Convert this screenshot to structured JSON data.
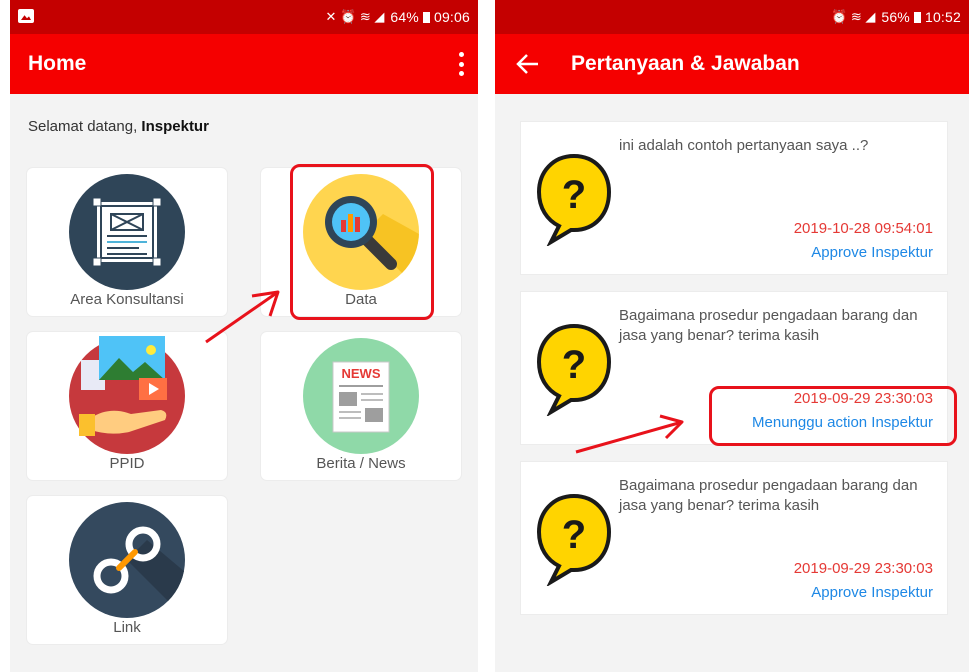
{
  "left_screen": {
    "status_bar": {
      "icons": "✕⚙ ✇ .▎",
      "battery": "64%",
      "time": "09:06"
    },
    "app_bar": {
      "title": "Home"
    },
    "welcome": {
      "prefix": "Selamat datang, ",
      "name": "Inspektur"
    },
    "tiles": [
      {
        "label": "Area Konsultansi",
        "icon": "blueprint-icon"
      },
      {
        "label": "Data",
        "icon": "magnifier-chart-icon"
      },
      {
        "label": "PPID",
        "icon": "media-hand-icon"
      },
      {
        "label": "Berita / News",
        "icon": "newspaper-icon",
        "badge": "NEWS"
      },
      {
        "label": "Link",
        "icon": "chain-link-icon"
      }
    ]
  },
  "right_screen": {
    "status_bar": {
      "battery": "56%",
      "time": "10:52"
    },
    "app_bar": {
      "title": "Pertanyaan & Jawaban"
    },
    "questions": [
      {
        "text": "ini adalah contoh pertanyaan saya ..?",
        "date": "2019-10-28 09:54:01",
        "status": "Approve Inspektur"
      },
      {
        "text": "Bagaimana prosedur pengadaan barang dan jasa yang benar? terima kasih",
        "date": "2019-09-29 23:30:03",
        "status": "Menunggu action Inspektur"
      },
      {
        "text": "Bagaimana prosedur pengadaan barang dan jasa yang benar? terima kasih",
        "date": "2019-09-29 23:30:03",
        "status": "Approve Inspektur"
      }
    ]
  },
  "colors": {
    "status_bar": "#c40000",
    "app_bar": "#f50000",
    "date_text": "#e53935",
    "status_text": "#1e88e5",
    "highlight": "#e8121b"
  }
}
